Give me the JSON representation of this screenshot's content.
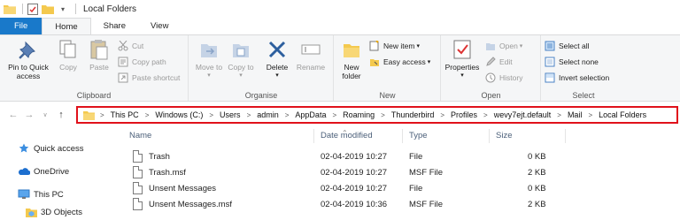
{
  "window": {
    "title": "Local Folders"
  },
  "tabs": [
    "File",
    "Home",
    "Share",
    "View"
  ],
  "ribbon": {
    "clipboard": {
      "label": "Clipboard",
      "pin": "Pin to Quick access",
      "copy": "Copy",
      "paste": "Paste",
      "cut": "Cut",
      "copy_path": "Copy path",
      "paste_shortcut": "Paste shortcut"
    },
    "organise": {
      "label": "Organise",
      "move_to": "Move to",
      "copy_to": "Copy to",
      "delete": "Delete",
      "rename": "Rename"
    },
    "new": {
      "label": "New",
      "new_folder": "New folder",
      "new_item": "New item",
      "easy_access": "Easy access"
    },
    "open": {
      "label": "Open",
      "properties": "Properties",
      "open": "Open",
      "edit": "Edit",
      "history": "History"
    },
    "select": {
      "label": "Select",
      "select_all": "Select all",
      "select_none": "Select none",
      "invert": "Invert selection"
    }
  },
  "breadcrumb": [
    "This PC",
    "Windows (C:)",
    "Users",
    "admin",
    "AppData",
    "Roaming",
    "Thunderbird",
    "Profiles",
    "wevy7ejt.default",
    "Mail",
    "Local Folders"
  ],
  "nav_pane": [
    "Quick access",
    "OneDrive",
    "This PC",
    "3D Objects"
  ],
  "columns": {
    "name": "Name",
    "date": "Date modified",
    "type": "Type",
    "size": "Size"
  },
  "files": [
    {
      "name": "Trash",
      "date": "02-04-2019 10:27",
      "type": "File",
      "size": "0 KB"
    },
    {
      "name": "Trash.msf",
      "date": "02-04-2019 10:27",
      "type": "MSF File",
      "size": "2 KB"
    },
    {
      "name": "Unsent Messages",
      "date": "02-04-2019 10:27",
      "type": "File",
      "size": "0 KB"
    },
    {
      "name": "Unsent Messages.msf",
      "date": "02-04-2019 10:36",
      "type": "MSF File",
      "size": "2 KB"
    }
  ],
  "colors": {
    "file_tab": "#1979ca",
    "address_highlight": "#e0111b",
    "folder": "#f4c94e"
  }
}
